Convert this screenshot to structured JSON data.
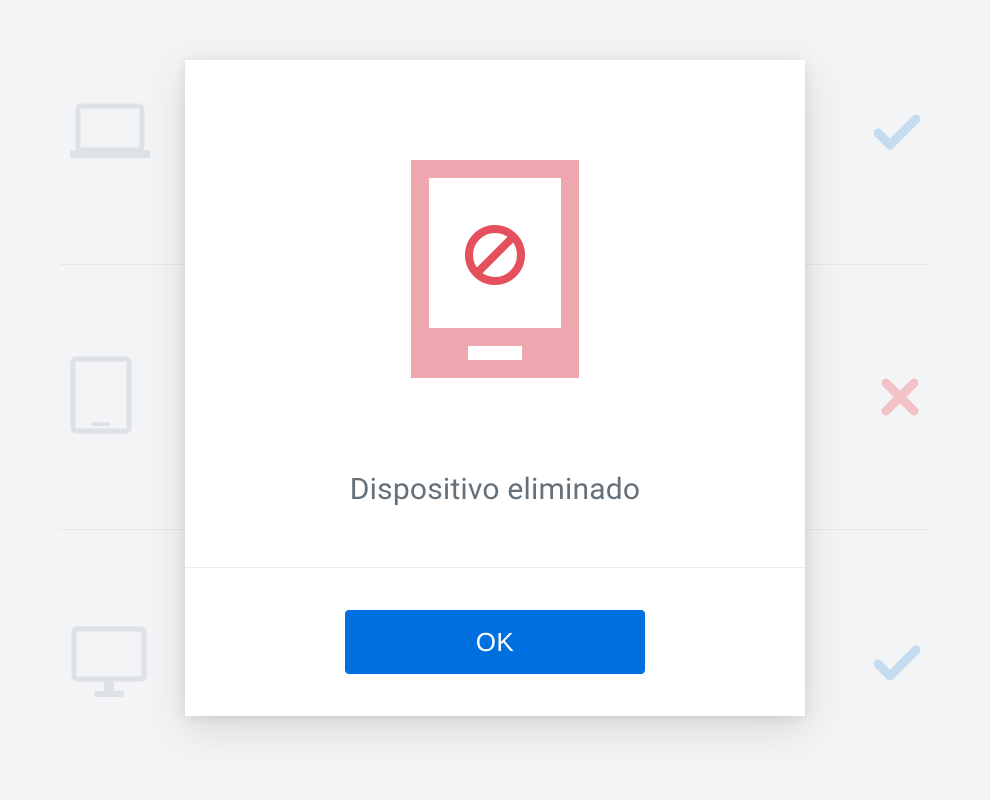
{
  "dialog": {
    "message": "Dispositivo eliminado",
    "ok_label": "OK"
  },
  "devices": [
    {
      "type": "laptop",
      "status": "active"
    },
    {
      "type": "tablet",
      "status": "removed"
    },
    {
      "type": "desktop",
      "status": "active"
    }
  ],
  "colors": {
    "accent": "#0070e0",
    "check": "#b9d6ef",
    "remove": "#f2b6bc",
    "illustration": "#eea7af",
    "illustration_dark": "#e4505e"
  }
}
